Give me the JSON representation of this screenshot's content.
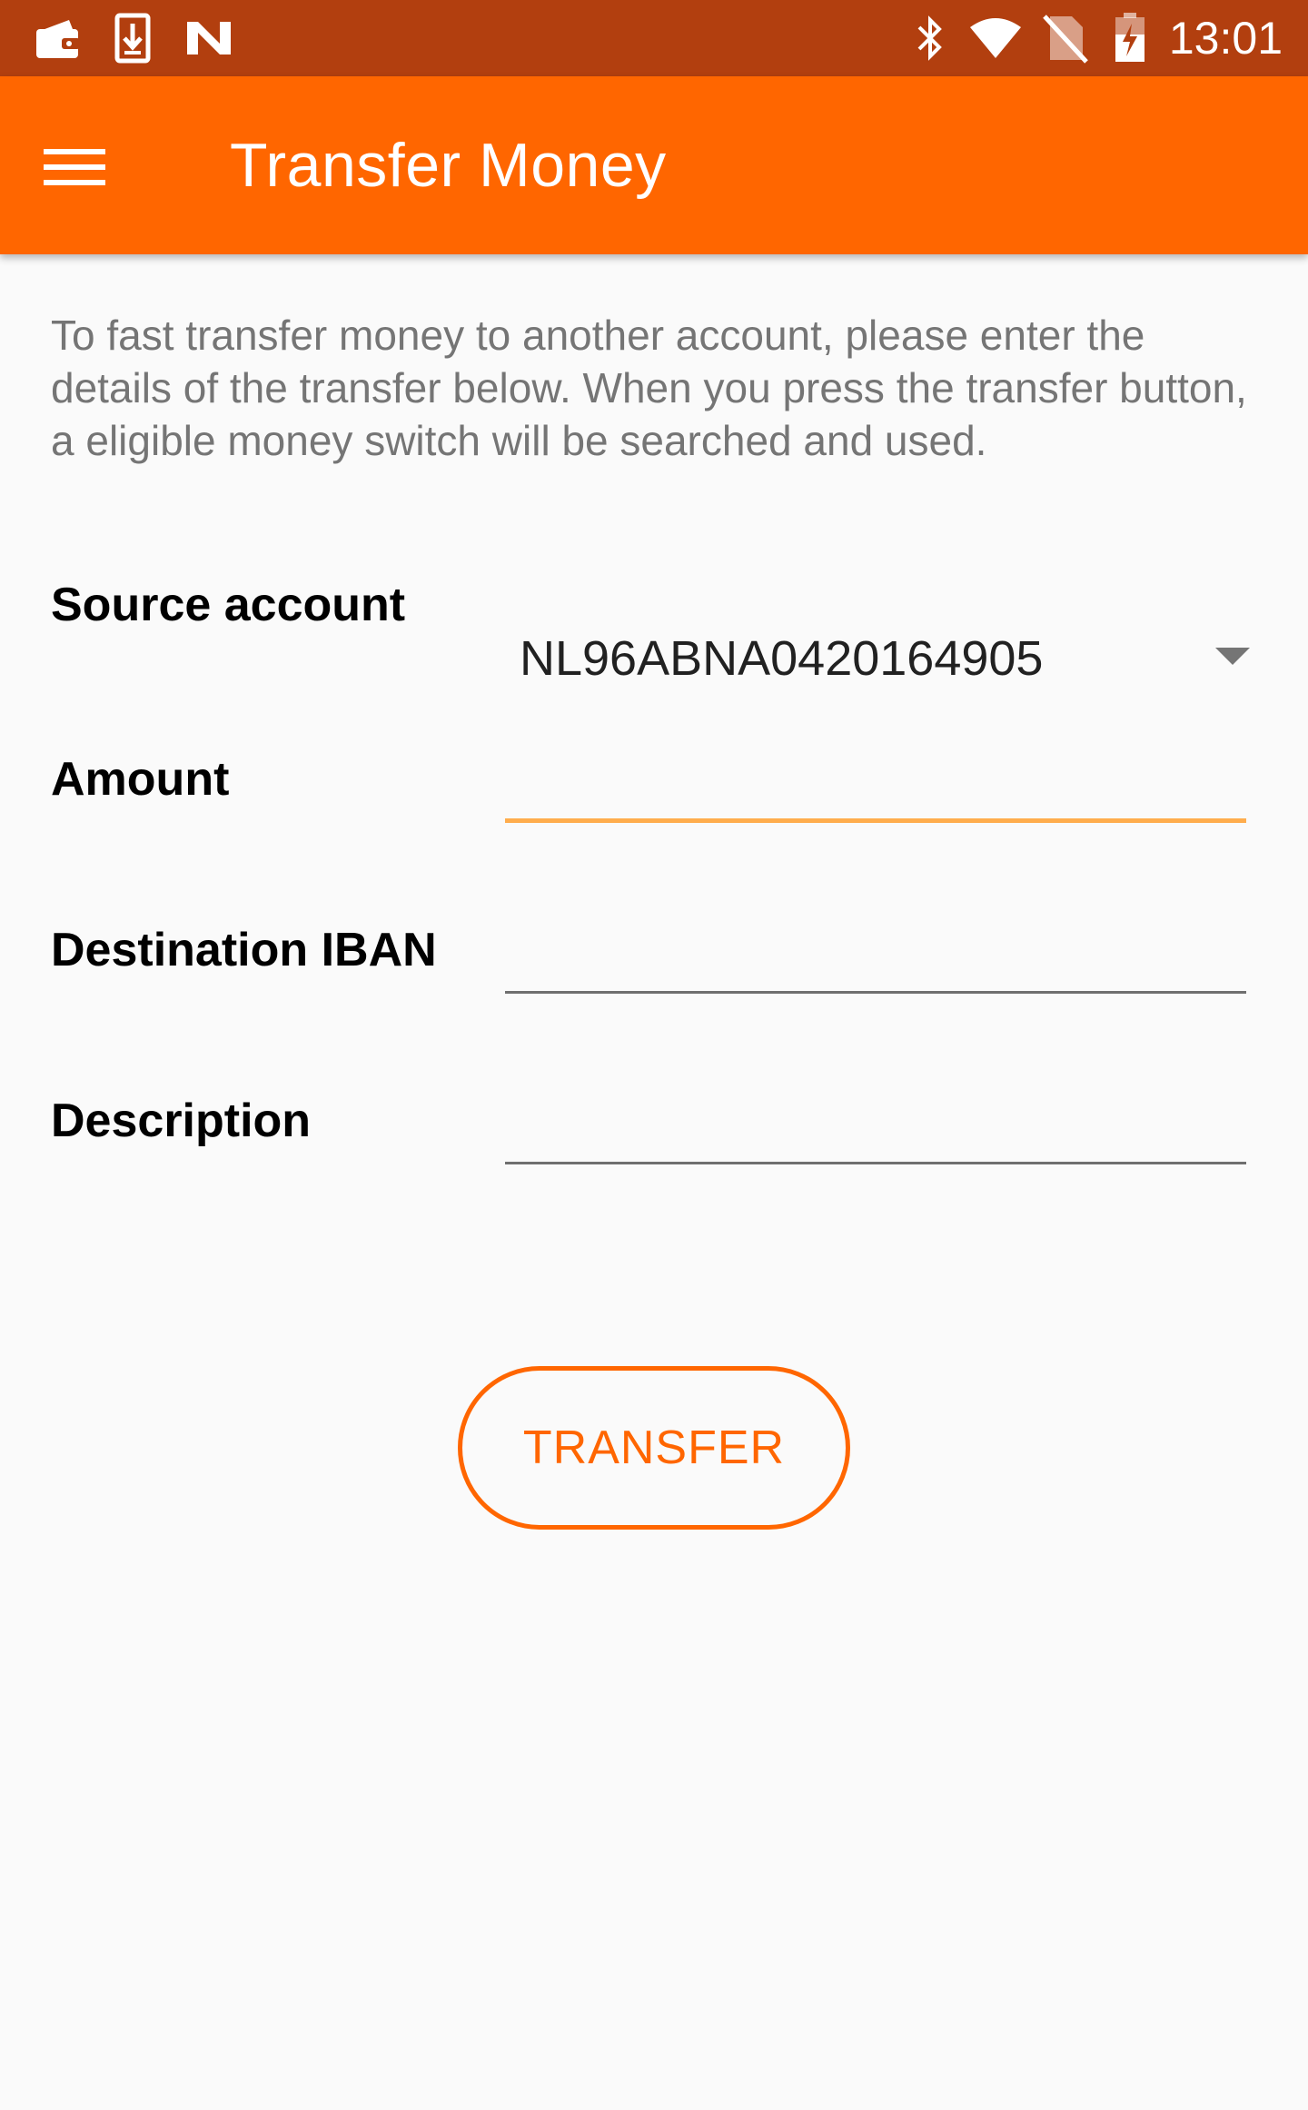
{
  "status_bar": {
    "time": "13:01",
    "icons_left": [
      "wallet-icon",
      "download-icon",
      "nfc-n-icon"
    ],
    "icons_right": [
      "bluetooth-icon",
      "wifi-icon",
      "no-sim-icon",
      "battery-charging-icon"
    ],
    "background_color": "#b23f0f"
  },
  "app_bar": {
    "title": "Transfer Money",
    "menu_icon": "hamburger-menu-icon",
    "background_color": "#ff6600"
  },
  "intro_text": "To fast transfer money to another account, please enter the details of the transfer below. When you press the transfer button, a eligible money switch will be searched and used.",
  "form": {
    "source_account": {
      "label": "Source account",
      "selected_value": "NL96ABNA0420164905"
    },
    "amount": {
      "label": "Amount",
      "value": ""
    },
    "destination_iban": {
      "label": "Destination IBAN",
      "value": ""
    },
    "description": {
      "label": "Description",
      "value": ""
    }
  },
  "transfer_button": {
    "label": "TRANSFER",
    "accent_color": "#ff6600"
  }
}
